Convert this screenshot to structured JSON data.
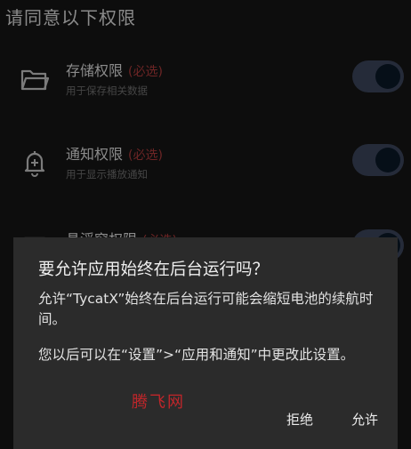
{
  "page": {
    "title": "请同意以下权限",
    "permissions": [
      {
        "name": "存储权限",
        "required": "(必选)",
        "description": "用于保存相关数据",
        "icon": "folder-icon",
        "enabled": true
      },
      {
        "name": "通知权限",
        "required": "(必选)",
        "description": "用于显示播放通知",
        "icon": "bell-plus-icon",
        "enabled": true
      },
      {
        "name": "悬浮窗权限",
        "required": "(必选)",
        "description": "",
        "icon": "window-icon",
        "enabled": true
      }
    ]
  },
  "dialog": {
    "title": "要允许应用始终在后台运行吗？",
    "body_1": "允许“TycatX”始终在后台运行可能会缩短电池的续航时间。",
    "body_2": "您以后可以在“设置”>“应用和通知”中更改此设置。",
    "watermark": "腾飞网",
    "deny_label": "拒绝",
    "allow_label": "允许"
  },
  "colors": {
    "background": "#141414",
    "dialog": "#2b2b2b",
    "required_text": "#a83a3a",
    "toggle_track": "#3a4358",
    "toggle_knob": "#0a1726",
    "watermark": "#c0262a"
  }
}
